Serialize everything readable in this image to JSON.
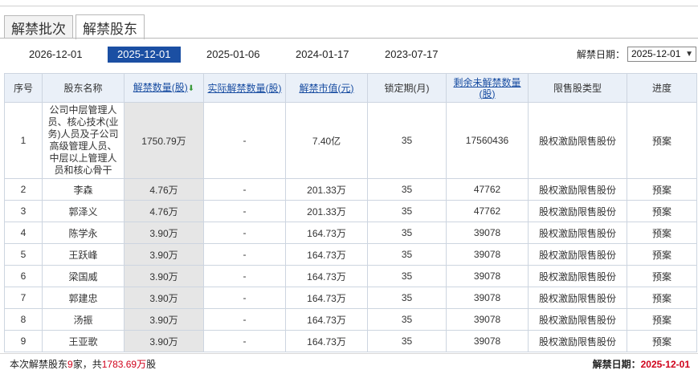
{
  "tabs": [
    {
      "label": "解禁批次",
      "active": false
    },
    {
      "label": "解禁股东",
      "active": true
    }
  ],
  "dates": [
    {
      "label": "2026-12-01",
      "active": false
    },
    {
      "label": "2025-12-01",
      "active": true
    },
    {
      "label": "2025-01-06",
      "active": false
    },
    {
      "label": "2024-01-17",
      "active": false
    },
    {
      "label": "2023-07-17",
      "active": false
    }
  ],
  "filter": {
    "label": "解禁日期：",
    "selected": "2025-12-01"
  },
  "table": {
    "headers": {
      "seq": "序号",
      "name": "股东名称",
      "unlock_qty": "解禁数量(股)",
      "actual_unlock_qty": "实际解禁数量(股)",
      "unlock_value": "解禁市值(元)",
      "lock_period": "锁定期(月)",
      "remaining": "剩余未解禁数量(股)",
      "share_type": "限售股类型",
      "progress": "进度"
    },
    "rows": [
      {
        "seq": "1",
        "name": "公司中层管理人员、核心技术(业务)人员及子公司高级管理人员、中层以上管理人员和核心骨干",
        "qty": "1750.79万",
        "actual": "-",
        "value": "7.40亿",
        "period": "35",
        "remaining": "17560436",
        "type": "股权激励限售股份",
        "progress": "预案"
      },
      {
        "seq": "2",
        "name": "李森",
        "qty": "4.76万",
        "actual": "-",
        "value": "201.33万",
        "period": "35",
        "remaining": "47762",
        "type": "股权激励限售股份",
        "progress": "预案"
      },
      {
        "seq": "3",
        "name": "郭泽义",
        "qty": "4.76万",
        "actual": "-",
        "value": "201.33万",
        "period": "35",
        "remaining": "47762",
        "type": "股权激励限售股份",
        "progress": "预案"
      },
      {
        "seq": "4",
        "name": "陈学永",
        "qty": "3.90万",
        "actual": "-",
        "value": "164.73万",
        "period": "35",
        "remaining": "39078",
        "type": "股权激励限售股份",
        "progress": "预案"
      },
      {
        "seq": "5",
        "name": "王跃峰",
        "qty": "3.90万",
        "actual": "-",
        "value": "164.73万",
        "period": "35",
        "remaining": "39078",
        "type": "股权激励限售股份",
        "progress": "预案"
      },
      {
        "seq": "6",
        "name": "梁国威",
        "qty": "3.90万",
        "actual": "-",
        "value": "164.73万",
        "period": "35",
        "remaining": "39078",
        "type": "股权激励限售股份",
        "progress": "预案"
      },
      {
        "seq": "7",
        "name": "郭建忠",
        "qty": "3.90万",
        "actual": "-",
        "value": "164.73万",
        "period": "35",
        "remaining": "39078",
        "type": "股权激励限售股份",
        "progress": "预案"
      },
      {
        "seq": "8",
        "name": "汤振",
        "qty": "3.90万",
        "actual": "-",
        "value": "164.73万",
        "period": "35",
        "remaining": "39078",
        "type": "股权激励限售股份",
        "progress": "预案"
      },
      {
        "seq": "9",
        "name": "王亚歌",
        "qty": "3.90万",
        "actual": "-",
        "value": "164.73万",
        "period": "35",
        "remaining": "39078",
        "type": "股权激励限售股份",
        "progress": "预案"
      }
    ]
  },
  "footer": {
    "prefix": "本次解禁股东",
    "holder_count": "9",
    "middle": "家，共",
    "total_qty": "1783.69万",
    "suffix": "股",
    "date_label": "解禁日期：",
    "date_value": "2025-12-01"
  },
  "colors": {
    "accent": "#1b4fa3",
    "link": "#1a4ea2",
    "highlight": "#d0021b",
    "header_bg": "#eaf0f8"
  }
}
